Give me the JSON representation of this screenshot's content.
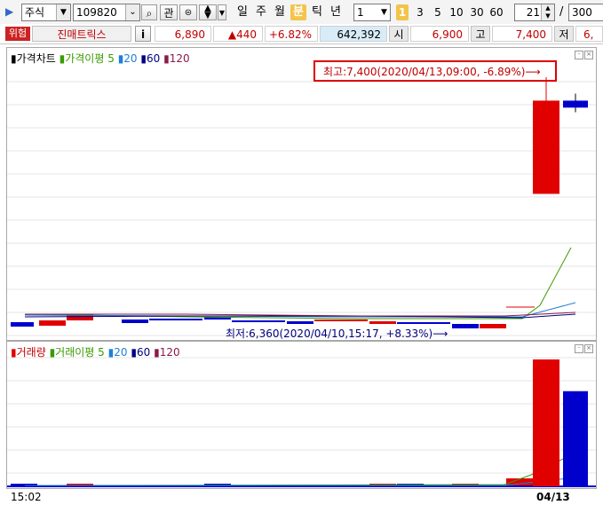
{
  "toolbar": {
    "market_select": "주식",
    "code": "109820",
    "search_glyph": "⌕",
    "gwan_label": "관",
    "periods": [
      {
        "label": "일",
        "active": false
      },
      {
        "label": "주",
        "active": false
      },
      {
        "label": "월",
        "active": false
      },
      {
        "label": "분",
        "active": true
      },
      {
        "label": "틱",
        "active": false
      },
      {
        "label": "년",
        "active": false
      }
    ],
    "interval_value": "1",
    "minute_buttons": [
      {
        "label": "1",
        "active": true
      },
      {
        "label": "3",
        "active": false
      },
      {
        "label": "5",
        "active": false
      },
      {
        "label": "10",
        "active": false
      },
      {
        "label": "30",
        "active": false
      },
      {
        "label": "60",
        "active": false
      }
    ],
    "count_value": "21",
    "slash": "/",
    "total_value": "300"
  },
  "info": {
    "warning_badge": "위험",
    "stock_name": "진매트릭스",
    "info_button": "i",
    "current_price": "6,890",
    "change": "▲440",
    "change_pct": "+6.82%",
    "volume": "642,392",
    "open_label": "시",
    "open_value": "6,900",
    "high_label": "고",
    "high_value": "7,400",
    "low_label": "저",
    "low_value": "6,"
  },
  "price_pane": {
    "legend_title": "가격차트",
    "legend_ma_label": "가격이평",
    "ma_periods": [
      "5",
      "20",
      "60",
      "120"
    ],
    "high_annotation": "최고:7,400(2020/04/13,09:00, -6.89%)⟶",
    "low_annotation": "최저:6,360(2020/04/10,15:17, +8.33%)⟶"
  },
  "volume_pane": {
    "legend_title": "거래량",
    "legend_ma_label": "거래이평",
    "ma_periods": [
      "5",
      "20",
      "60",
      "120"
    ]
  },
  "x_axis": {
    "left_label": "15:02",
    "right_label": "04/13"
  },
  "colors": {
    "up": "#e00000",
    "down": "#0000cc",
    "ma5": "#3a9a00",
    "ma20": "#1e7fd8",
    "ma60": "#000080",
    "ma120": "#8b1a4a",
    "active": "#f2c44a"
  },
  "chart_data": {
    "type": "candlestick",
    "candles": [
      {
        "o": 6900,
        "h": 7400,
        "l": 6900,
        "c": 7300,
        "dir": "up"
      },
      {
        "o": 7300,
        "h": 7330,
        "l": 7250,
        "c": 7270,
        "dir": "down"
      }
    ],
    "ylim": [
      6300,
      7450
    ],
    "volumes": [
      {
        "v": 1,
        "dir": "up"
      },
      {
        "v": 0.75,
        "dir": "down"
      }
    ]
  }
}
